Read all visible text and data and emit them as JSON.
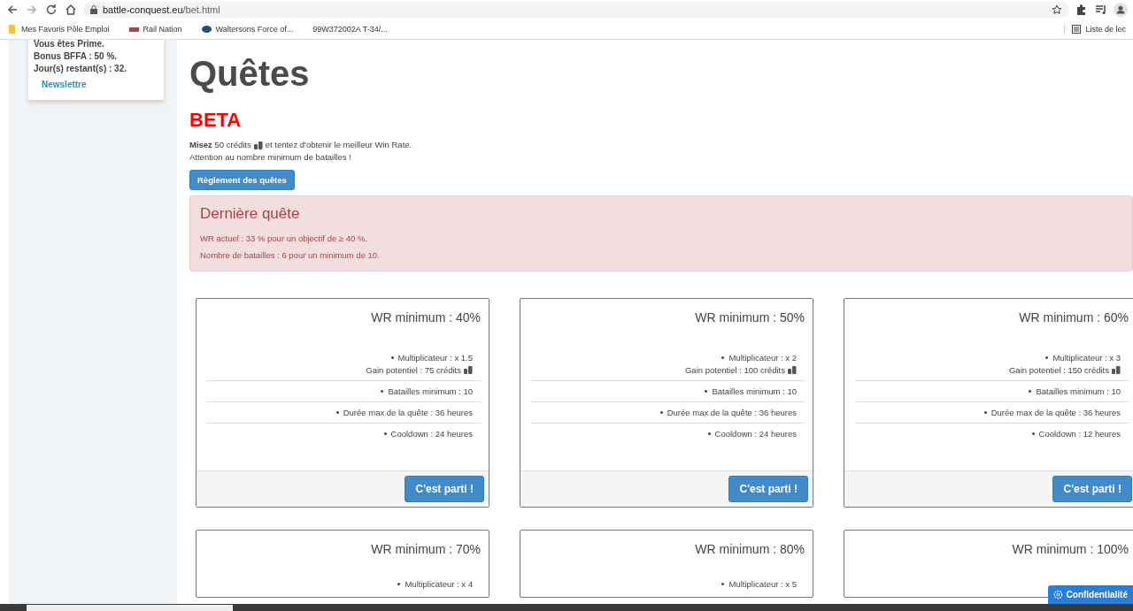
{
  "browser": {
    "url_host": "battle-conquest.eu",
    "url_path": "/bet.html",
    "bookmarks": [
      "Mes Favoris Pôle Emploi",
      "Rail Nation",
      "Waltersons Force of...",
      "99W372002A T-34/..."
    ],
    "reading_list": "Liste de lec"
  },
  "sidebar": {
    "lines": [
      "Vous êtes Prime.",
      "Bonus BFFA : 50 %.",
      "Jour(s) restant(s) : 32."
    ],
    "link": "Newslettre"
  },
  "title": "Quêtes",
  "beta": "BETA",
  "intro": {
    "before": "**Misez** 50 crédits",
    "after": "et tentez d'obtenir le meilleur Win Rate.",
    "warning": "Attention au nombre minimum de batailles !"
  },
  "rules_button": "Règlement des quêtes",
  "last_quest": {
    "title": "Dernière quête",
    "lines": [
      "WR actuel : 33 % pour un objectif de ≥ 40 %.",
      "Nombre de batailles : 6 pour un minimum de 10."
    ]
  },
  "quests": [
    {
      "title": "WR minimum : 40%",
      "multiplier": "Multiplicateur : x 1.5",
      "gain": "Gain potentiel : 75 crédits",
      "battles": "Batailles minimum : 10",
      "duration": "Durée max de la quête : 36 heures",
      "cooldown": "Cooldown : 24 heures",
      "button": "C'est parti !"
    },
    {
      "title": "WR minimum : 50%",
      "multiplier": "Multiplicateur : x 2",
      "gain": "Gain potentiel : 100 crédits",
      "battles": "Batailles minimum : 10",
      "duration": "Durée max de la quête : 36 heures",
      "cooldown": "Cooldown : 24 heures",
      "button": "C'est parti !"
    },
    {
      "title": "WR minimum : 60%",
      "multiplier": "Multiplicateur : x 3",
      "gain": "Gain potentiel : 150 crédits",
      "battles": "Batailles minimum : 10",
      "duration": "Durée max de la quête : 36 heures",
      "cooldown": "Cooldown : 12 heures",
      "button": "C'est parti !"
    },
    {
      "title": "WR minimum : 70%",
      "multiplier": "Multiplicateur : x 4"
    },
    {
      "title": "WR minimum : 80%",
      "multiplier": "Multiplicateur : x 5"
    },
    {
      "title": "WR minimum : 100%"
    }
  ],
  "privacy_button": "Confidentialité"
}
